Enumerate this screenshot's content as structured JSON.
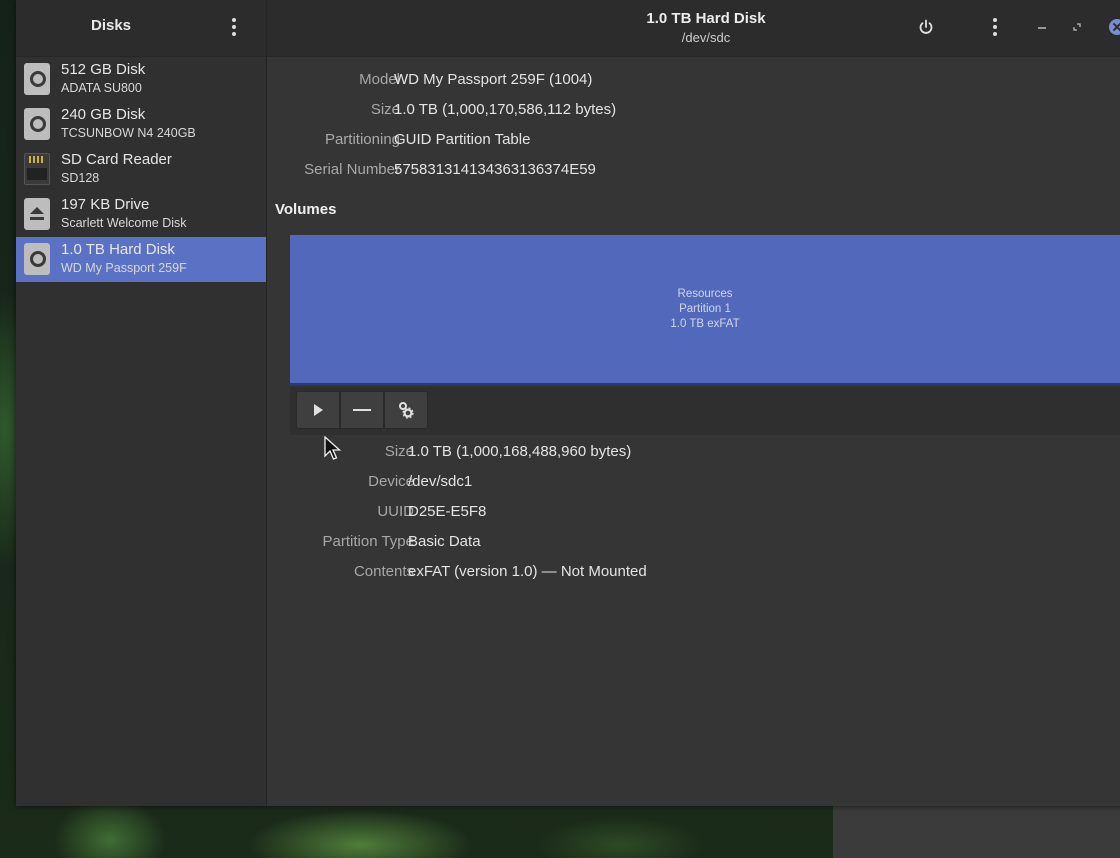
{
  "sidebar": {
    "title": "Disks",
    "items": [
      {
        "name": "512 GB Disk",
        "sub": "ADATA SU800",
        "icon": "hard-disk-icon"
      },
      {
        "name": "240 GB Disk",
        "sub": "TCSUNBOW N4 240GB",
        "icon": "hard-disk-icon"
      },
      {
        "name": "SD Card Reader",
        "sub": "SD128",
        "icon": "sd-card-reader-icon"
      },
      {
        "name": "197 KB Drive",
        "sub": "Scarlett Welcome Disk",
        "icon": "removable-drive-icon"
      },
      {
        "name": "1.0 TB Hard Disk",
        "sub": "WD My Passport 259F",
        "icon": "hard-disk-icon",
        "selected": true
      }
    ]
  },
  "header": {
    "title": "1.0 TB Hard Disk",
    "subtitle": "/dev/sdc"
  },
  "disk_info": {
    "model_label": "Model",
    "model": "WD My Passport 259F (1004)",
    "size_label": "Size",
    "size": "1.0 TB (1,000,170,586,112 bytes)",
    "partitioning_label": "Partitioning",
    "partitioning": "GUID Partition Table",
    "serial_label": "Serial Number",
    "serial": "575831314134363136374E59"
  },
  "volumes": {
    "heading": "Volumes",
    "partition": {
      "name": "Resources",
      "number": "Partition 1",
      "summary": "1.0 TB exFAT"
    }
  },
  "partition_info": {
    "size_label": "Size",
    "size": "1.0 TB (1,000,168,488,960 bytes)",
    "device_label": "Device",
    "device": "/dev/sdc1",
    "uuid_label": "UUID",
    "uuid": "D25E-E5F8",
    "type_label": "Partition Type",
    "type": "Basic Data",
    "contents_label": "Contents",
    "contents": "exFAT (version 1.0) — Not Mounted"
  },
  "colors": {
    "selection": "#5b72c4",
    "partition": "#5268ba"
  }
}
